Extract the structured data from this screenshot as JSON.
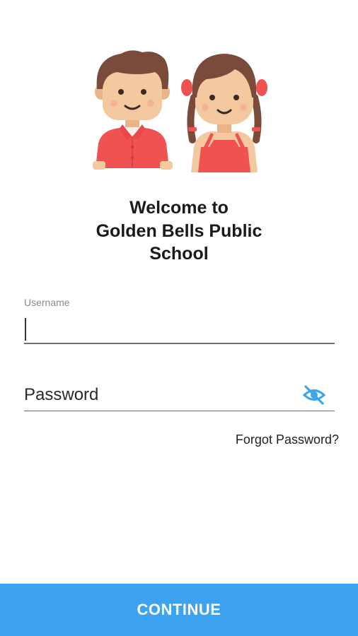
{
  "header": {
    "illustration": "boy-and-girl-illustration"
  },
  "welcome": {
    "line1": "Welcome to",
    "line2": "Golden Bells Public",
    "line3": "School"
  },
  "username": {
    "label": "Username",
    "value": ""
  },
  "password": {
    "placeholder": "Password",
    "value": "",
    "toggle_icon": "eye-off-icon"
  },
  "links": {
    "forgot_password": "Forgot Password?"
  },
  "actions": {
    "continue_label": "CONTINUE"
  },
  "colors": {
    "accent": "#3da3f0",
    "kid_shirt": "#f05252",
    "hair": "#7a4a3a",
    "skin": "#f5c9a0"
  }
}
